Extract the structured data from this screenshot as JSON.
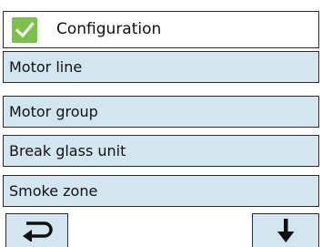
{
  "header": {
    "title": "Configuration",
    "checkbox_checked": true,
    "check_color": "#7cc24a"
  },
  "menu": {
    "items": [
      {
        "label": "Motor line"
      },
      {
        "label": "Motor group"
      },
      {
        "label": "Break glass unit"
      },
      {
        "label": "Smoke zone"
      }
    ]
  },
  "footer": {
    "back_icon": "return-arrow-icon",
    "down_icon": "down-arrow-icon"
  },
  "colors": {
    "item_background": "#d3e5ef",
    "border": "#2a2a2a"
  }
}
